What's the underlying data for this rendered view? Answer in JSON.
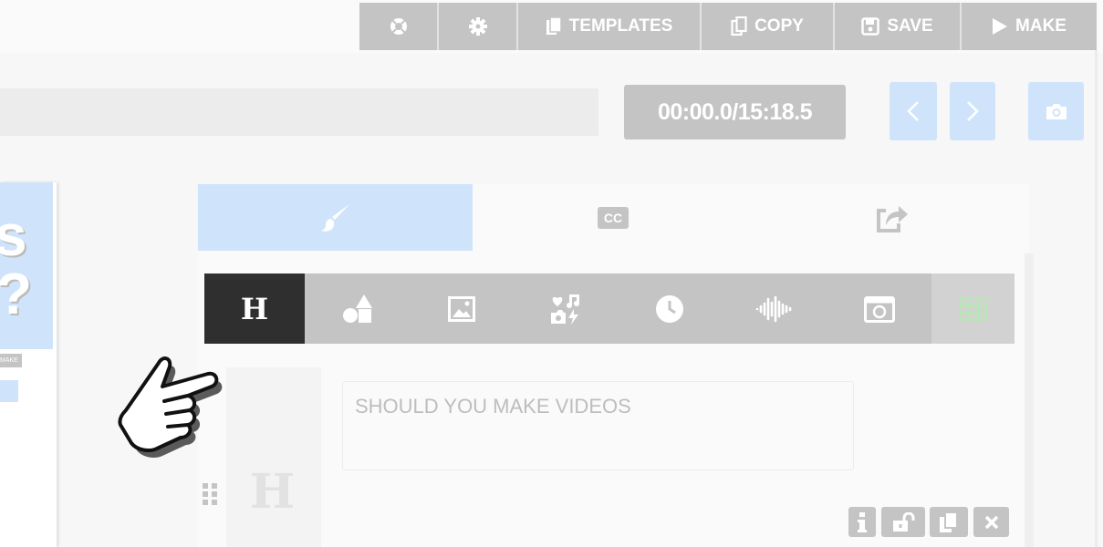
{
  "toolbar": {
    "help_icon": "lifebuoy-icon",
    "settings_icon": "gear-icon",
    "templates_label": "TEMPLATES",
    "copy_label": "COPY",
    "save_label": "SAVE",
    "make_label": "MAKE"
  },
  "player": {
    "time": "00:00.0/15:18.5"
  },
  "preview": {
    "big_text_1": "s",
    "big_text_2": "?",
    "mini_label": "MAKE"
  },
  "tabs": [
    {
      "name": "style",
      "icon": "paintbrush-icon",
      "active": true
    },
    {
      "name": "captions",
      "icon": "cc-icon",
      "active": false
    },
    {
      "name": "share",
      "icon": "share-icon",
      "active": false
    }
  ],
  "element_toolbar": [
    {
      "name": "heading",
      "glyph": "H",
      "active": true
    },
    {
      "name": "shapes",
      "icon": "shapes-icon"
    },
    {
      "name": "image",
      "icon": "image-icon"
    },
    {
      "name": "stickers",
      "icon": "stickers-icon"
    },
    {
      "name": "timer",
      "icon": "clock-icon"
    },
    {
      "name": "audio",
      "icon": "waveform-icon"
    },
    {
      "name": "screenshot",
      "icon": "camera-frame-icon"
    },
    {
      "name": "grid",
      "icon": "grid-icon"
    }
  ],
  "editor": {
    "text_value": "SHOULD YOU MAKE VIDEOS",
    "layer_glyph": "H"
  },
  "colors": {
    "toolbar_gray": "#c4c4c4",
    "active_blue": "#cfe4fb",
    "dark": "#2f2f2f",
    "grid_green": "#b8e6b6"
  }
}
